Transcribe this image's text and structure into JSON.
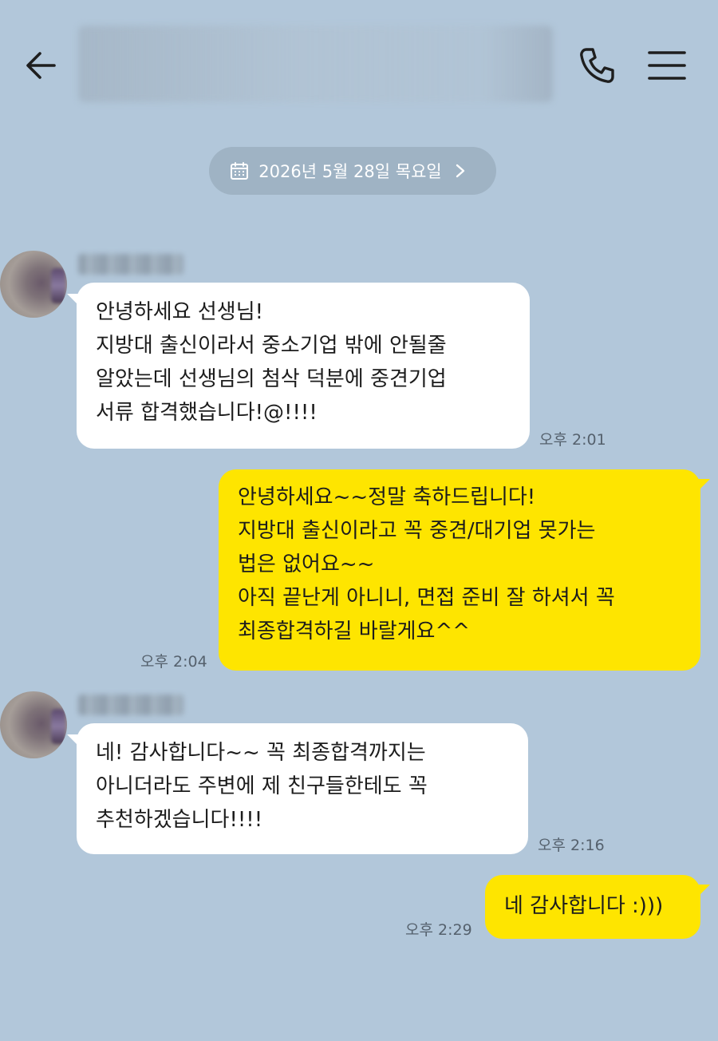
{
  "header": {
    "back_icon": "arrow-left-icon",
    "call_icon": "phone-icon",
    "menu_icon": "hamburger-menu-icon"
  },
  "date_divider": {
    "label": "2026년 5월 28일 목요일",
    "icon": "calendar-icon"
  },
  "messages": [
    {
      "direction": "incoming",
      "text": "안녕하세요 선생님!\n지방대 출신이라서 중소기업 밖에 안될줄\n알았는데 선생님의 첨삭 덕분에 중견기업\n서류 합격했습니다!@!!!!",
      "time": "오후 2:01"
    },
    {
      "direction": "outgoing",
      "text": "안녕하세요~~정말 축하드립니다!\n지방대 출신이라고 꼭 중견/대기업 못가는\n법은 없어요~~\n아직 끝난게 아니니, 면접 준비 잘 하셔서 꼭\n최종합격하길 바랄게요^^",
      "time": "오후 2:04"
    },
    {
      "direction": "incoming",
      "text": "네! 감사합니다~~ 꼭 최종합격까지는\n아니더라도 주변에 제 친구들한테도 꼭\n추천하겠습니다!!!!",
      "time": "오후 2:16"
    },
    {
      "direction": "outgoing",
      "text": "네 감사합니다 :)))",
      "time": "오후 2:29"
    }
  ],
  "colors": {
    "background": "#b2c7da",
    "outgoing_bubble": "#fee500",
    "incoming_bubble": "#ffffff",
    "date_pill": "#9fb3c4"
  }
}
